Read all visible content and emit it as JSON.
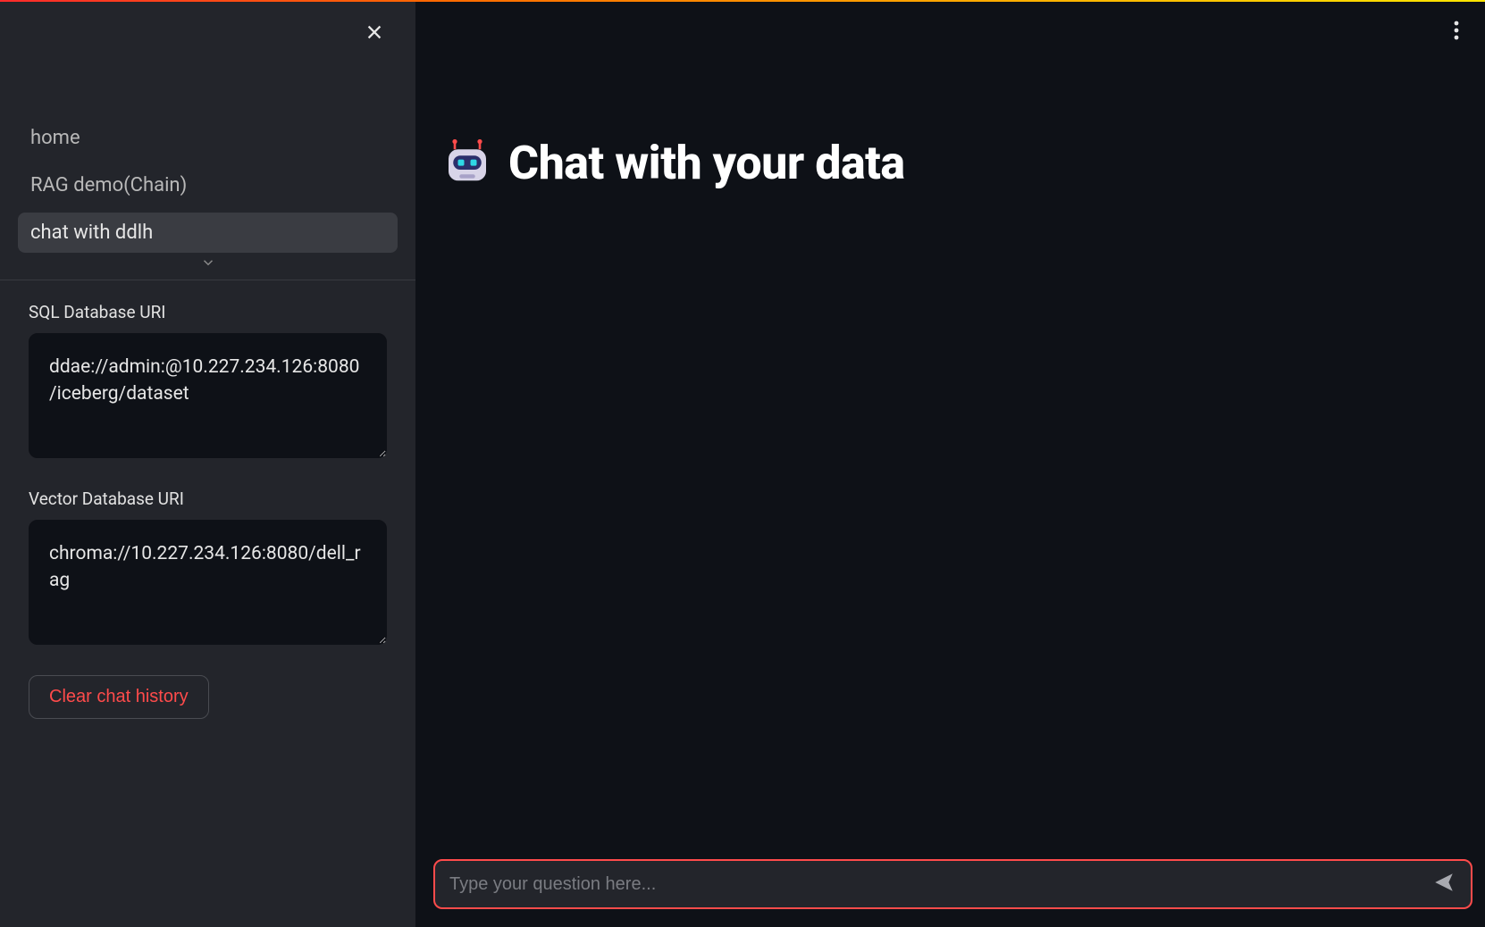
{
  "sidebar": {
    "nav": [
      {
        "label": "home",
        "selected": false
      },
      {
        "label": "RAG demo(Chain)",
        "selected": false
      },
      {
        "label": "chat with ddlh",
        "selected": true
      }
    ],
    "sql_uri": {
      "label": "SQL Database URI",
      "value": "ddae://admin:@10.227.234.126:8080/iceberg/dataset"
    },
    "vector_uri": {
      "label": "Vector Database URI",
      "value": "chroma://10.227.234.126:8080/dell_rag"
    },
    "clear_button": "Clear chat history"
  },
  "main": {
    "title": "Chat with your data",
    "chat_placeholder": "Type your question here..."
  }
}
